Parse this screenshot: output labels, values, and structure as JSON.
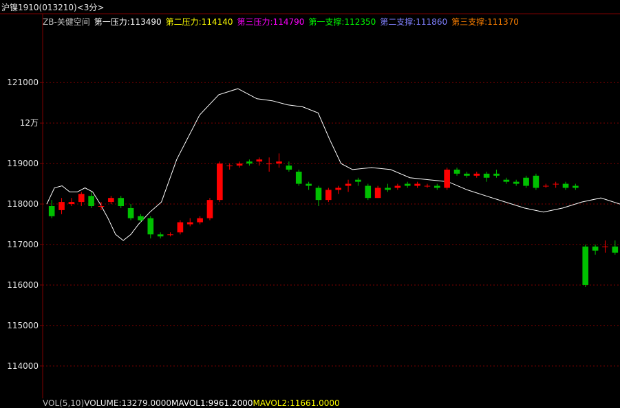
{
  "title": "沪镍1910(013210)<3分>",
  "legend": [
    {
      "label": "ZB-关健空间",
      "color": "#c0c0c0"
    },
    {
      "label": "第一压力:113490",
      "color": "#ffffff"
    },
    {
      "label": "第二压力:114140",
      "color": "#ffff00"
    },
    {
      "label": "第三压力:114790",
      "color": "#ff00ff"
    },
    {
      "label": "第一支撑:112350",
      "color": "#00ff00"
    },
    {
      "label": "第二支撑:111860",
      "color": "#8080ff"
    },
    {
      "label": "第三支撑:111370",
      "color": "#ff8000"
    }
  ],
  "bottombar": [
    {
      "label": "VOL(5,10)",
      "color": "#c0c0c0"
    },
    {
      "label": "VOLUME:13279.0000",
      "color": "#e6e6e6"
    },
    {
      "label": "MAVOL1:9961.2000",
      "color": "#ffffff"
    },
    {
      "label": "MAVOL2:11661.0000",
      "color": "#ffff00"
    }
  ],
  "colors": {
    "background": "#000000",
    "grid": "#800000",
    "up": "#ff0000",
    "down": "#00c000",
    "down_special": "#0080ff"
  },
  "chart_data": {
    "type": "candlestick",
    "ylim": [
      113200,
      122700
    ],
    "yticks": [
      {
        "value": 121000,
        "label": "121000"
      },
      {
        "value": 120000,
        "label": "12万"
      },
      {
        "value": 119000,
        "label": "119000"
      },
      {
        "value": 118000,
        "label": "118000"
      },
      {
        "value": 117000,
        "label": "117000"
      },
      {
        "value": 116000,
        "label": "116000"
      },
      {
        "value": 115000,
        "label": "115000"
      },
      {
        "value": 114000,
        "label": "114000"
      }
    ],
    "candles": [
      [
        117950,
        117700,
        118100,
        117650
      ],
      [
        117850,
        118050,
        118150,
        117750
      ],
      [
        118000,
        118050,
        118150,
        117950
      ],
      [
        118050,
        118250,
        118300,
        117950
      ],
      [
        118200,
        117950,
        118300,
        117900
      ],
      [
        117950,
        117950,
        118050,
        117850
      ],
      [
        118050,
        118150,
        118200,
        118000
      ],
      [
        118150,
        117950,
        118200,
        117900
      ],
      [
        117900,
        117650,
        118000,
        117600
      ],
      [
        117700,
        117600,
        117750,
        117550
      ],
      [
        117650,
        117250,
        117700,
        117150
      ],
      [
        117250,
        117200,
        117300,
        117150
      ],
      [
        117250,
        117250,
        117300,
        117200
      ],
      [
        117300,
        117550,
        117600,
        117250
      ],
      [
        117500,
        117550,
        117650,
        117450
      ],
      [
        117550,
        117650,
        117700,
        117500
      ],
      [
        117650,
        118100,
        118150,
        117600
      ],
      [
        118100,
        119000,
        119050,
        118050
      ],
      [
        118950,
        118950,
        119000,
        118850
      ],
      [
        118950,
        119000,
        119050,
        118900
      ],
      [
        119050,
        119000,
        119100,
        118950
      ],
      [
        119050,
        119100,
        119150,
        118950
      ],
      [
        119000,
        119000,
        119150,
        118800
      ],
      [
        119000,
        119050,
        119250,
        118900
      ],
      [
        118950,
        118850,
        119050,
        118800
      ],
      [
        118800,
        118500,
        118850,
        118450
      ],
      [
        118500,
        118450,
        118550,
        118350
      ],
      [
        118400,
        118100,
        118450,
        117950
      ],
      [
        118100,
        118350,
        118400,
        118050
      ],
      [
        118350,
        118400,
        118450,
        118250
      ],
      [
        118450,
        118500,
        118600,
        118300
      ],
      [
        118600,
        118550,
        118650,
        118450
      ],
      [
        118450,
        118150,
        118500,
        118100
      ],
      [
        118150,
        118400,
        118450,
        118150
      ],
      [
        118400,
        118350,
        118500,
        118300
      ],
      [
        118400,
        118450,
        118500,
        118350
      ],
      [
        118500,
        118450,
        118550,
        118400
      ],
      [
        118450,
        118500,
        118550,
        118400
      ],
      [
        118450,
        118450,
        118500,
        118400
      ],
      [
        118450,
        118400,
        118500,
        118350
      ],
      [
        118400,
        118850,
        118900,
        118350
      ],
      [
        118850,
        118750,
        118900,
        118700
      ],
      [
        118750,
        118700,
        118800,
        118650
      ],
      [
        118700,
        118750,
        118800,
        118650
      ],
      [
        118750,
        118650,
        118800,
        118550
      ],
      [
        118750,
        118700,
        118850,
        118650
      ],
      [
        118600,
        118550,
        118650,
        118500
      ],
      [
        118550,
        118500,
        118600,
        118450
      ],
      [
        118650,
        118450,
        118700,
        118400
      ],
      [
        118700,
        118400,
        118750,
        118350
      ],
      [
        118450,
        118450,
        118500,
        118400
      ],
      [
        118500,
        118500,
        118550,
        118400
      ],
      [
        118500,
        118400,
        118550,
        118350
      ],
      [
        118450,
        118400,
        118500,
        118350
      ],
      [
        116950,
        116000,
        117000,
        115950
      ],
      [
        116950,
        116850,
        117000,
        116750
      ],
      [
        116950,
        116950,
        117100,
        116800
      ],
      [
        116950,
        116800,
        117100,
        116750
      ]
    ],
    "series": [
      {
        "name": "第一压力",
        "color": "#ffffff",
        "points": [
          [
            0,
            118000
          ],
          [
            4,
            118400
          ],
          [
            8,
            118450
          ],
          [
            12,
            118300
          ],
          [
            16,
            118300
          ],
          [
            20,
            118400
          ],
          [
            24,
            118300
          ],
          [
            28,
            118000
          ],
          [
            32,
            117650
          ],
          [
            36,
            117250
          ],
          [
            40,
            117100
          ],
          [
            44,
            117250
          ],
          [
            48,
            117500
          ],
          [
            54,
            117800
          ],
          [
            60,
            118050
          ],
          [
            68,
            119100
          ],
          [
            80,
            120200
          ],
          [
            90,
            120700
          ],
          [
            100,
            120850
          ],
          [
            110,
            120600
          ],
          [
            118,
            120550
          ],
          [
            126,
            120450
          ],
          [
            134,
            120400
          ],
          [
            142,
            120250
          ],
          [
            148,
            119600
          ],
          [
            154,
            119000
          ],
          [
            160,
            118850
          ],
          [
            170,
            118900
          ],
          [
            180,
            118850
          ],
          [
            190,
            118650
          ],
          [
            200,
            118600
          ],
          [
            210,
            118550
          ],
          [
            220,
            118350
          ],
          [
            230,
            118200
          ],
          [
            240,
            118050
          ],
          [
            250,
            117900
          ],
          [
            260,
            117800
          ],
          [
            270,
            117900
          ],
          [
            280,
            118050
          ],
          [
            290,
            118150
          ],
          [
            300,
            118000
          ]
        ]
      }
    ]
  }
}
